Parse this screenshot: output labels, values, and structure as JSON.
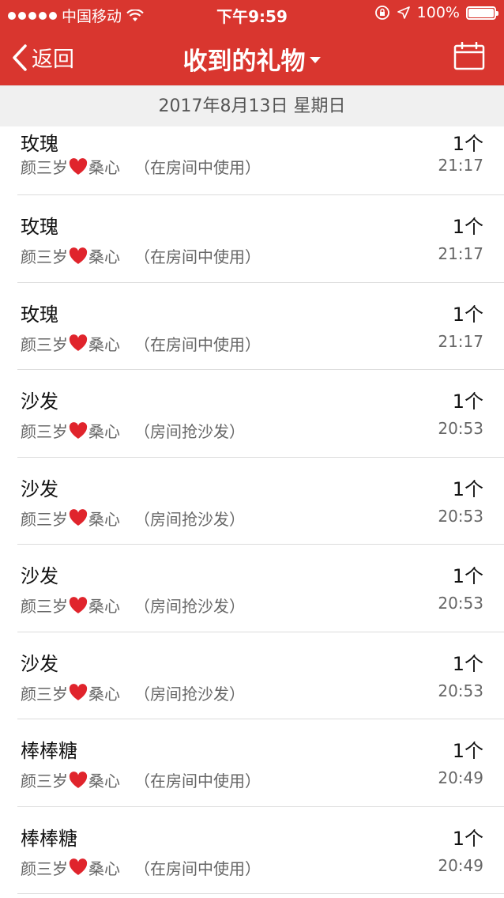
{
  "status_bar": {
    "carrier": "中国移动",
    "time": "下午9:59",
    "battery": "100%"
  },
  "nav": {
    "back_label": "返回",
    "title": "收到的礼物"
  },
  "date_header": "2017年8月13日 星期日",
  "colors": {
    "header_bg": "#d9362f",
    "heart": "#e0242c"
  },
  "gifts": [
    {
      "name": "玫瑰",
      "sender_a": "颜三岁",
      "sender_b": "桑心",
      "note": "（在房间中使用）",
      "qty": "1个",
      "time": "21:17"
    },
    {
      "name": "玫瑰",
      "sender_a": "颜三岁",
      "sender_b": "桑心",
      "note": "（在房间中使用）",
      "qty": "1个",
      "time": "21:17"
    },
    {
      "name": "玫瑰",
      "sender_a": "颜三岁",
      "sender_b": "桑心",
      "note": "（在房间中使用）",
      "qty": "1个",
      "time": "21:17"
    },
    {
      "name": "沙发",
      "sender_a": "颜三岁",
      "sender_b": "桑心",
      "note": "（房间抢沙发）",
      "qty": "1个",
      "time": "20:53"
    },
    {
      "name": "沙发",
      "sender_a": "颜三岁",
      "sender_b": "桑心",
      "note": "（房间抢沙发）",
      "qty": "1个",
      "time": "20:53"
    },
    {
      "name": "沙发",
      "sender_a": "颜三岁",
      "sender_b": "桑心",
      "note": "（房间抢沙发）",
      "qty": "1个",
      "time": "20:53"
    },
    {
      "name": "沙发",
      "sender_a": "颜三岁",
      "sender_b": "桑心",
      "note": "（房间抢沙发）",
      "qty": "1个",
      "time": "20:53"
    },
    {
      "name": "棒棒糖",
      "sender_a": "颜三岁",
      "sender_b": "桑心",
      "note": "（在房间中使用）",
      "qty": "1个",
      "time": "20:49"
    },
    {
      "name": "棒棒糖",
      "sender_a": "颜三岁",
      "sender_b": "桑心",
      "note": "（在房间中使用）",
      "qty": "1个",
      "time": "20:49"
    }
  ]
}
